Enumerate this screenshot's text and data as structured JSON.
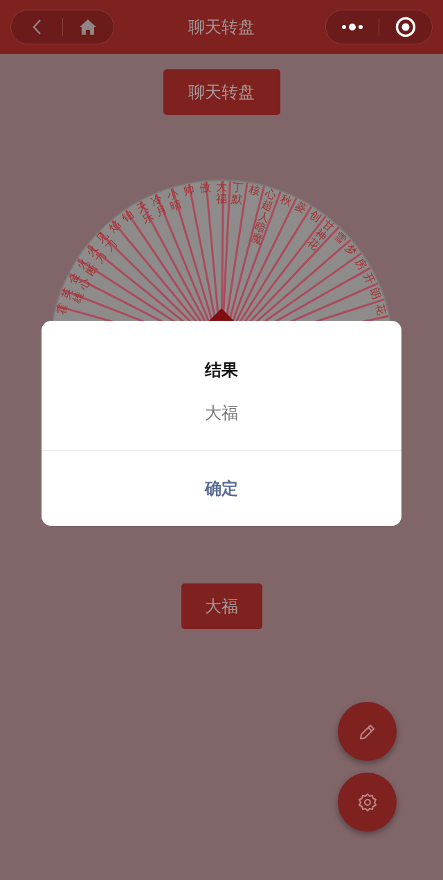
{
  "nav": {
    "title": "聊天转盘"
  },
  "title_button": "聊天转盘",
  "wheel": {
    "segments": [
      {
        "label": "霍"
      },
      {
        "label": "英雄"
      },
      {
        "label": "金心"
      },
      {
        "label": "火断"
      },
      {
        "label": "火力"
      },
      {
        "label": "见刀"
      },
      {
        "label": "焰"
      },
      {
        "label": "铂"
      },
      {
        "label": "天乐"
      },
      {
        "label": "冷月"
      },
      {
        "label": "小晴"
      },
      {
        "label": "帅"
      },
      {
        "label": "傲"
      },
      {
        "label": "大福"
      },
      {
        "label": "丁默"
      },
      {
        "label": "核"
      },
      {
        "label": "心超人暗魔"
      },
      {
        "label": "秋"
      },
      {
        "label": "菱"
      },
      {
        "label": "创"
      },
      {
        "label": "甘神花"
      },
      {
        "label": "雪"
      },
      {
        "label": "梦"
      },
      {
        "label": "房"
      },
      {
        "label": "开"
      },
      {
        "label": "朗"
      },
      {
        "label": "花"
      }
    ]
  },
  "result_button": "大福",
  "dialog": {
    "title": "结果",
    "content": "大福",
    "confirm": "确定"
  }
}
